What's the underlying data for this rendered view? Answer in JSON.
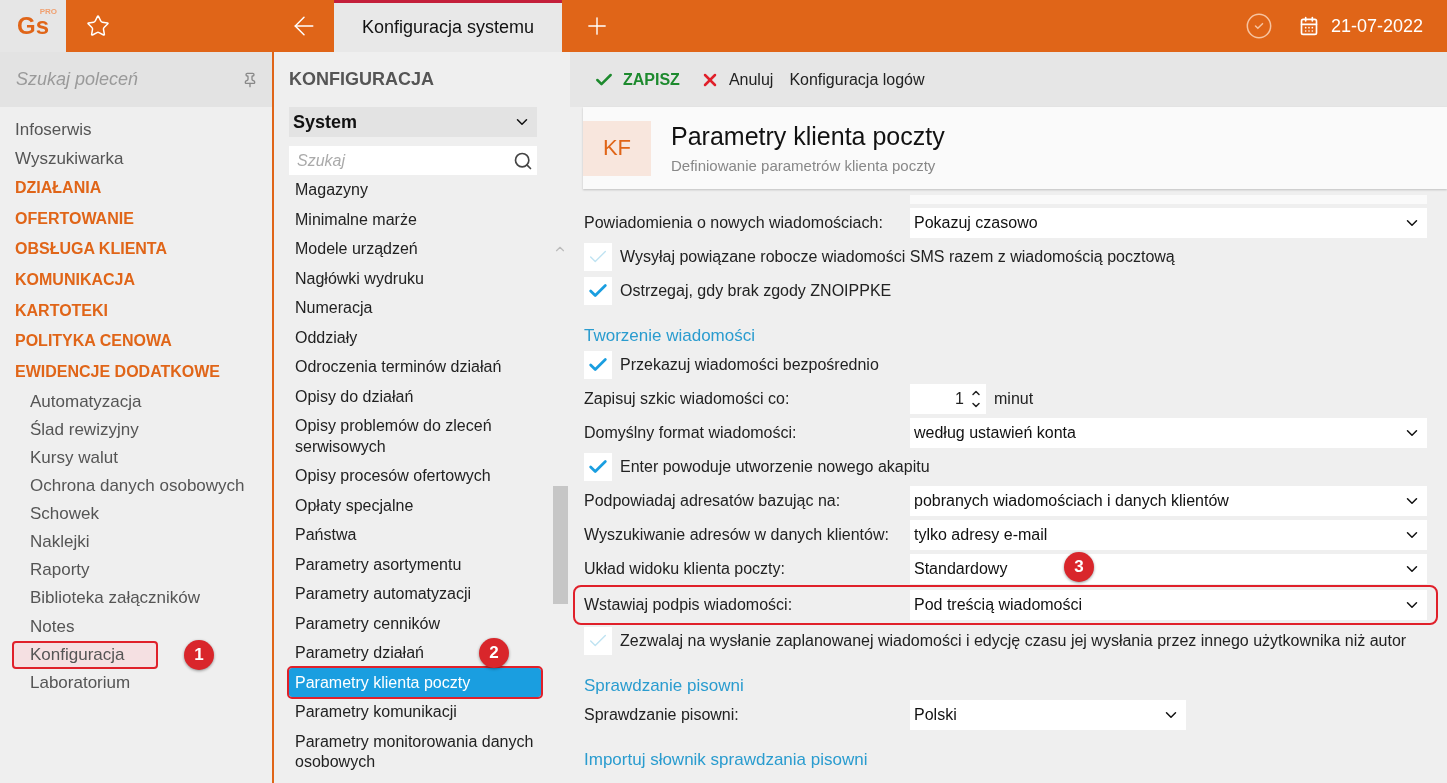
{
  "topbar": {
    "logo": "Gs",
    "logo_badge": "PRO",
    "tabs": [
      {
        "label": "Konfiguracja systemu",
        "selected": true
      }
    ],
    "date": "21-07-2022"
  },
  "sidebar": {
    "search_placeholder": "Szukaj poleceń",
    "items": [
      {
        "label": "Infoserwis",
        "kind": "link",
        "selected": false
      },
      {
        "label": "Wyszukiwarka",
        "kind": "link",
        "selected": false
      },
      {
        "label": "DZIAŁANIA",
        "kind": "heading",
        "selected": false
      },
      {
        "label": "OFERTOWANIE",
        "kind": "heading",
        "selected": false
      },
      {
        "label": "OBSŁUGA KLIENTA",
        "kind": "heading",
        "selected": false
      },
      {
        "label": "KOMUNIKACJA",
        "kind": "heading",
        "selected": false
      },
      {
        "label": "KARTOTEKI",
        "kind": "heading",
        "selected": false
      },
      {
        "label": "POLITYKA CENOWA",
        "kind": "heading",
        "selected": false
      },
      {
        "label": "EWIDENCJE DODATKOWE",
        "kind": "heading",
        "selected": false
      },
      {
        "label": "Automatyzacja",
        "kind": "sub",
        "selected": false
      },
      {
        "label": "Ślad rewizyjny",
        "kind": "sub",
        "selected": false
      },
      {
        "label": "Kursy walut",
        "kind": "sub",
        "selected": false
      },
      {
        "label": "Ochrona danych osobowych",
        "kind": "sub",
        "selected": false
      },
      {
        "label": "Schowek",
        "kind": "sub",
        "selected": false
      },
      {
        "label": "Naklejki",
        "kind": "sub",
        "selected": false
      },
      {
        "label": "Raporty",
        "kind": "sub",
        "selected": false
      },
      {
        "label": "Biblioteka załączników",
        "kind": "sub",
        "selected": false
      },
      {
        "label": "Notes",
        "kind": "sub",
        "selected": false
      },
      {
        "label": "Konfiguracja",
        "kind": "sub",
        "selected": true,
        "callout": "1"
      },
      {
        "label": "Laboratorium",
        "kind": "sub",
        "selected": false
      }
    ]
  },
  "config": {
    "title": "KONFIGURACJA",
    "category": "System",
    "search_placeholder": "Szukaj",
    "items": [
      {
        "label": "Magazyny",
        "selected": false
      },
      {
        "label": "Minimalne marże",
        "selected": false
      },
      {
        "label": "Modele urządzeń",
        "selected": false
      },
      {
        "label": "Nagłówki wydruku",
        "selected": false
      },
      {
        "label": "Numeracja",
        "selected": false
      },
      {
        "label": "Oddziały",
        "selected": false
      },
      {
        "label": "Odroczenia terminów działań",
        "selected": false
      },
      {
        "label": "Opisy do działań",
        "selected": false
      },
      {
        "label": "Opisy problemów do zleceń serwisowych",
        "selected": false
      },
      {
        "label": "Opisy procesów ofertowych",
        "selected": false
      },
      {
        "label": "Opłaty specjalne",
        "selected": false
      },
      {
        "label": "Państwa",
        "selected": false
      },
      {
        "label": "Parametry asortymentu",
        "selected": false
      },
      {
        "label": "Parametry automatyzacji",
        "selected": false
      },
      {
        "label": "Parametry cenników",
        "selected": false
      },
      {
        "label": "Parametry działań",
        "selected": false
      },
      {
        "label": "Parametry klienta poczty",
        "selected": true,
        "callout": "2"
      },
      {
        "label": "Parametry komunikacji",
        "selected": false
      },
      {
        "label": "Parametry monitorowania danych osobowych",
        "selected": false
      }
    ]
  },
  "toolbar": {
    "save": "ZAPISZ",
    "cancel": "Anuluj",
    "logs": "Konfiguracja logów"
  },
  "header": {
    "badge": "KF",
    "title": "Parametry klienta poczty",
    "subtitle": "Definiowanie parametrów klienta poczty"
  },
  "form": [
    {
      "kind": "select",
      "label": "Powiadomienia o nowych wiadomościach:",
      "value": "Pokazuj czasowo"
    },
    {
      "kind": "checkbox",
      "label": "Wysyłaj powiązane robocze wiadomości SMS razem z wiadomością pocztową",
      "checked": false
    },
    {
      "kind": "checkbox",
      "label": "Ostrzegaj, gdy brak zgody ZNOIPPKE",
      "checked": true
    },
    {
      "kind": "section",
      "label": "Tworzenie wiadomości"
    },
    {
      "kind": "checkbox",
      "label": "Przekazuj wiadomości bezpośrednio",
      "checked": true
    },
    {
      "kind": "spinner",
      "label": "Zapisuj szkic wiadomości co:",
      "value": "1",
      "unit": "minut"
    },
    {
      "kind": "select",
      "label": "Domyślny format wiadomości:",
      "value": "według ustawień konta"
    },
    {
      "kind": "checkbox",
      "label": "Enter powoduje utworzenie nowego akapitu",
      "checked": true
    },
    {
      "kind": "select",
      "label": "Podpowiadaj adresatów bazując na:",
      "value": "pobranych wiadomościach i danych klientów"
    },
    {
      "kind": "select",
      "label": "Wyszukiwanie adresów w danych klientów:",
      "value": "tylko adresy e-mail"
    },
    {
      "kind": "select",
      "label": "Układ widoku klienta poczty:",
      "value": "Standardowy"
    },
    {
      "kind": "select",
      "label": "Wstawiaj podpis wiadomości:",
      "value": "Pod treścią wiadomości",
      "callout": "3"
    },
    {
      "kind": "checkbox",
      "label": "Zezwalaj na wysłanie zaplanowanej wiadomości i edycję czasu jej wysłania przez innego użytkownika niż autor",
      "checked": false
    },
    {
      "kind": "section",
      "label": "Sprawdzanie pisowni"
    },
    {
      "kind": "smallselect",
      "label": "Sprawdzanie pisowni:",
      "value": "Polski"
    },
    {
      "kind": "section",
      "label": "Importuj słownik sprawdzania pisowni"
    }
  ]
}
